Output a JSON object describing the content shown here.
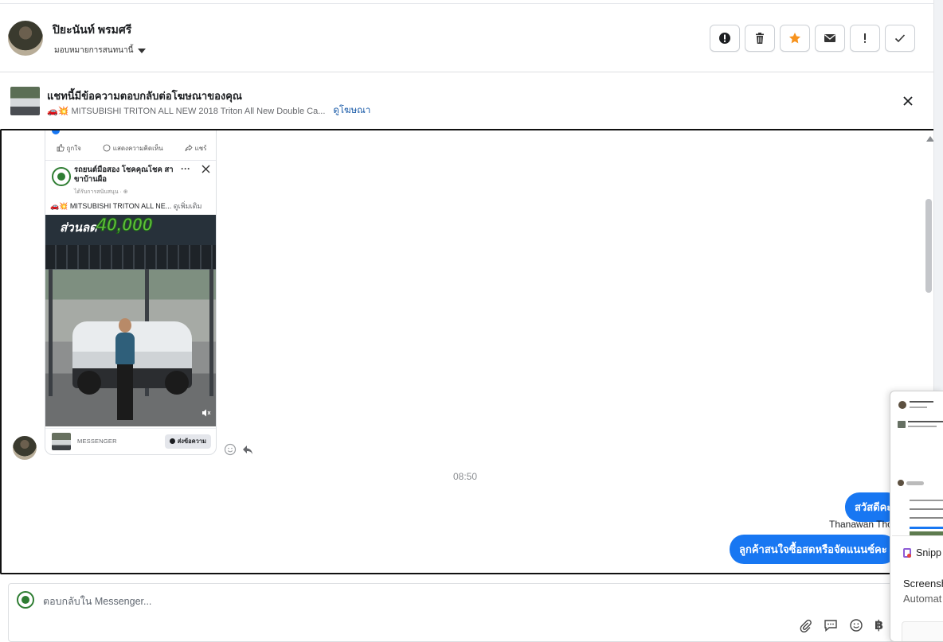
{
  "header": {
    "contact_name": "ปิยะนันท์ พรมศรี",
    "assign_label": "มอบหมายการสนทนานี้",
    "actions": [
      "mark-spam",
      "delete",
      "star",
      "mark-unread",
      "important",
      "done"
    ]
  },
  "ad_banner": {
    "title": "แชทนี้มีข้อความตอบกลับต่อโฆษณาของคุณ",
    "emoji": "🚗💥",
    "ad_text": "MITSUBISHI TRITON ALL NEW 2018 Triton All New Double Ca...",
    "view_ad_link": "ดูโฆษณา"
  },
  "ad_card": {
    "reactions": {
      "like": "ถูกใจ",
      "comment": "แสดงความคิดเห็น",
      "share": "แชร์"
    },
    "page_name": "รถยนต์มือสอง โชคคุณโชค สาขาบ้านผือ",
    "meta": "ได้รับการสนับสนุน · ⊕",
    "caption": "🚗💥 MITSUBISHI TRITON ALL NE...",
    "caption_more": "ดูเพิ่มเติม",
    "sale_text": "ส่วนลด",
    "sale_amount": "40,000",
    "footer_label": "MESSENGER",
    "footer_button": "ส่งข้อความ"
  },
  "messages": {
    "timestamp": "08:50",
    "outgoing_1": "สวัสดีคะ",
    "sender_name": "Thanawan Tho",
    "outgoing_2": "ลูกค้าสนใจซื้อสดหรือจัดแนนซ์คะ"
  },
  "composer": {
    "placeholder": "ตอบกลับใน Messenger...",
    "currency_symbol": "฿"
  },
  "snip_overlay": {
    "app_name": "Snipp",
    "heading": "Screensh",
    "subtext": "Automat"
  },
  "colors": {
    "accent": "#1877f2",
    "star": "#f7931e",
    "link": "#1a5ba8"
  }
}
